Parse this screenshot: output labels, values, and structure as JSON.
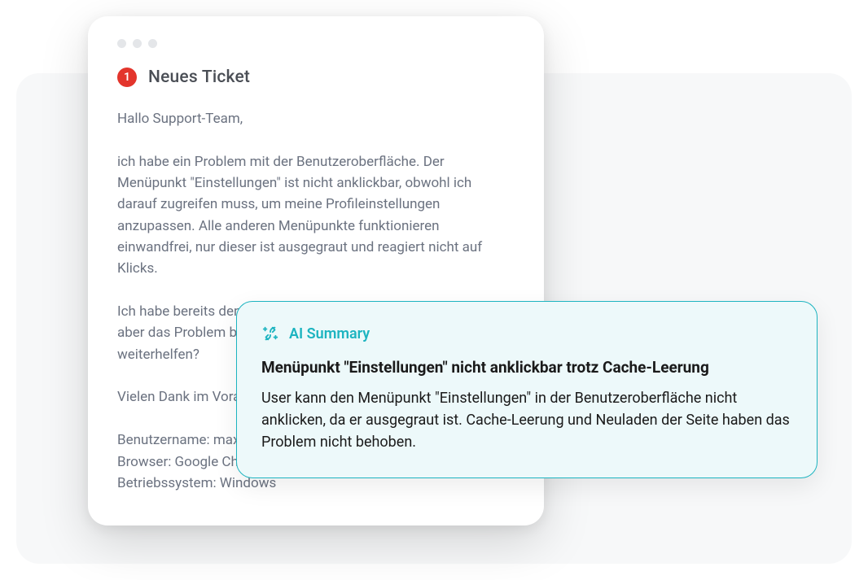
{
  "ticket": {
    "badge": "1",
    "title": "Neues Ticket",
    "body": "Hallo Support-Team,\n\nich habe ein Problem mit der Benutzeroberfläche. Der Menüpunkt \"Einstellungen\" ist nicht anklickbar, obwohl ich darauf zugreifen muss, um meine Profileinstellungen anzupassen. Alle anderen Menüpunkte funktionieren einwandfrei, nur dieser ist ausgegraut und reagiert nicht auf Klicks.\n\nIch habe bereits den Cache geleert und die Seite neu geladen, aber das Problem besteht weiterhin. Können Sie bitte weiterhelfen?\n\nVielen Dank im Voraus.\n\nBenutzername: max.mustermann\nBrowser: Google Chrome\nBetriebssystem: Windows"
  },
  "summary": {
    "label": "AI Summary",
    "title": "Menüpunkt \"Einstellungen\" nicht anklickbar trotz Cache-Leerung",
    "text": "User kann den Menüpunkt \"Einstellungen\" in der Benutzeroberfläche nicht anklicken, da er ausgegraut ist. Cache-Leerung und Neuladen der Seite haben das Problem nicht behoben."
  }
}
